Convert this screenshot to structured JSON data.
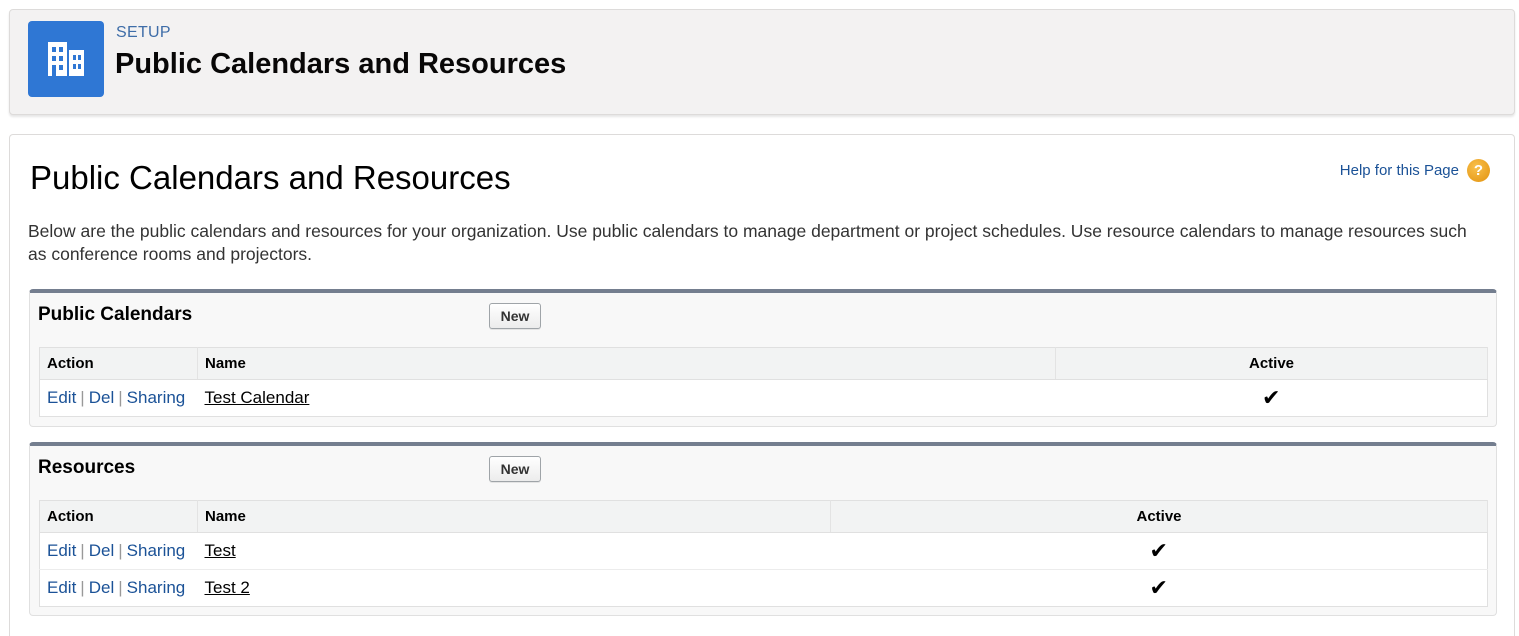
{
  "header": {
    "icon": "building-icon",
    "eyebrow": "SETUP",
    "title": "Public Calendars and Resources"
  },
  "page": {
    "title": "Public Calendars and Resources",
    "help_label": "Help for this Page",
    "help_icon": "help-question-icon",
    "description": "Below are the public calendars and resources for your organization. Use public calendars to manage department or project schedules. Use resource calendars to manage resources such as conference rooms and projectors."
  },
  "public_calendars": {
    "title": "Public Calendars",
    "new_label": "New",
    "columns": [
      "Action",
      "Name",
      "Active"
    ],
    "rows": [
      {
        "edit": "Edit",
        "del": "Del",
        "sharing": "Sharing",
        "name": "Test Calendar",
        "active": "✔"
      }
    ]
  },
  "resources": {
    "title": "Resources",
    "new_label": "New",
    "columns": [
      "Action",
      "Name",
      "Active"
    ],
    "rows": [
      {
        "edit": "Edit",
        "del": "Del",
        "sharing": "Sharing",
        "name": "Test",
        "active": "✔"
      },
      {
        "edit": "Edit",
        "del": "Del",
        "sharing": "Sharing",
        "name": "Test 2",
        "active": "✔"
      }
    ]
  },
  "colors": {
    "brand_icon": "#2f77d4",
    "link": "#1b5297",
    "block_border": "#747e8f"
  }
}
